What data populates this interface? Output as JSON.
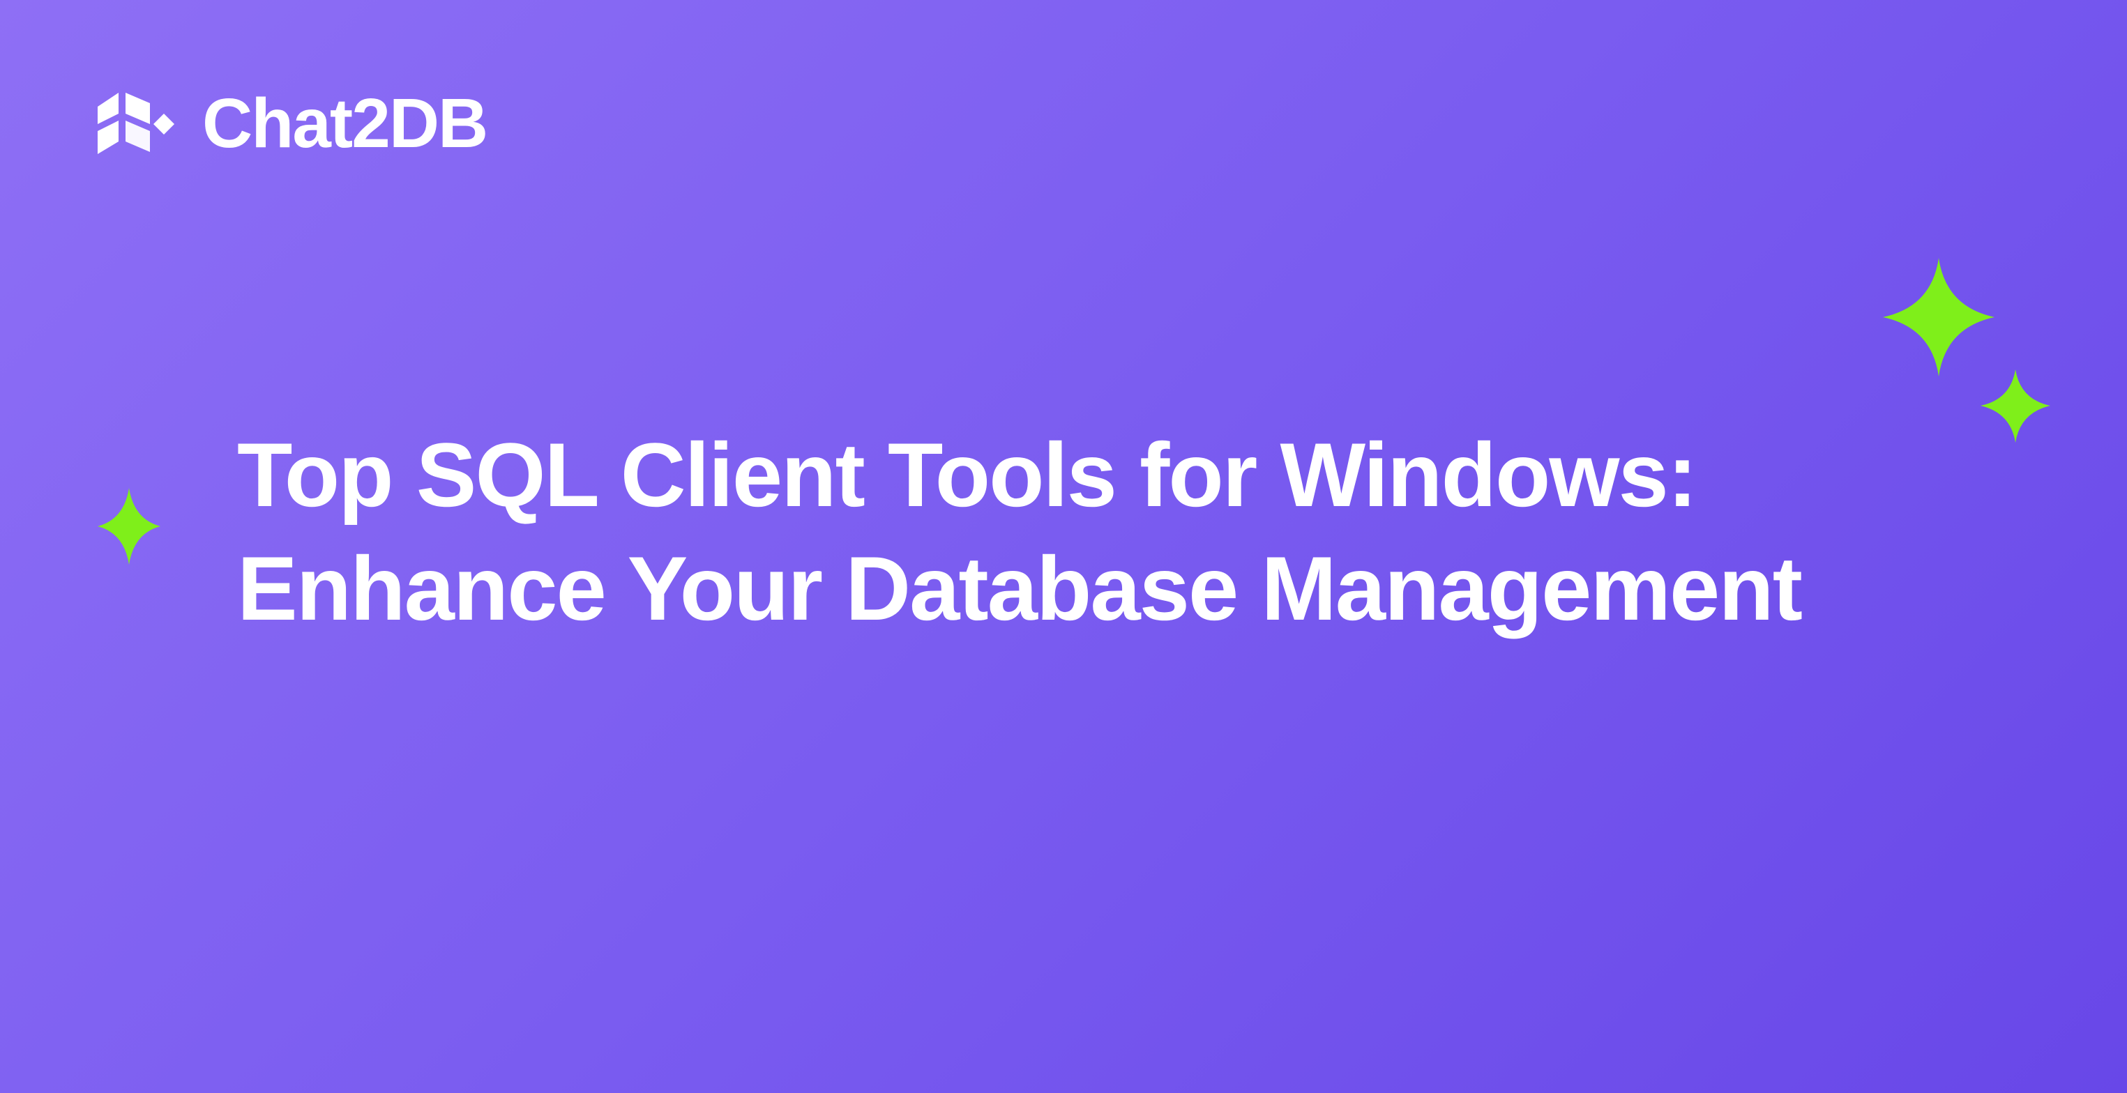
{
  "brand": {
    "name": "Chat2DB"
  },
  "headline": "Top SQL Client Tools for Windows: Enhance Your Database Management",
  "colors": {
    "accent_green": "#7fef1a",
    "text_white": "#ffffff"
  }
}
